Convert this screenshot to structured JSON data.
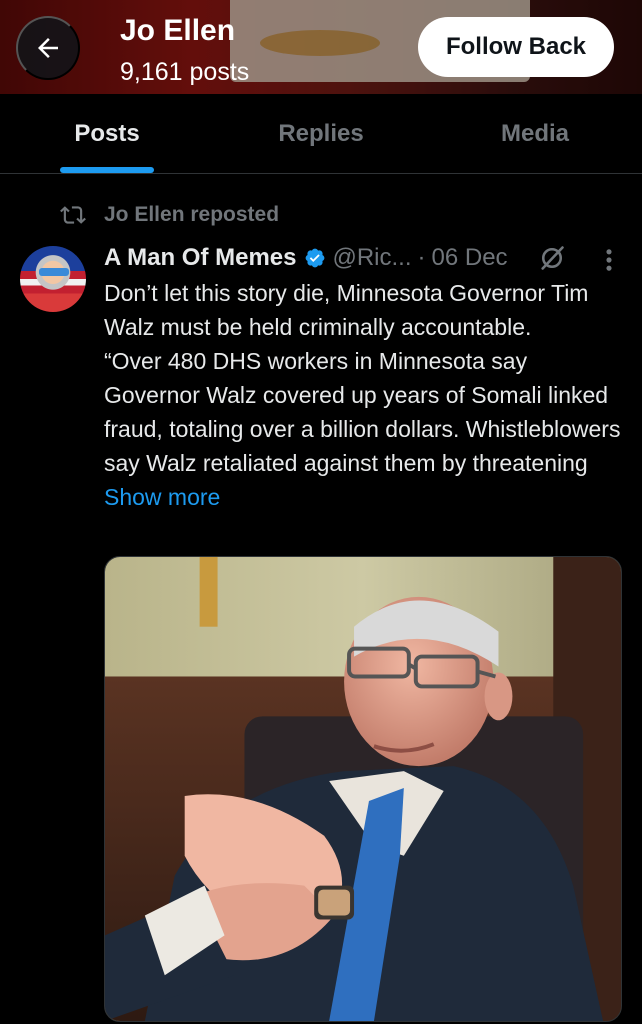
{
  "header": {
    "back_icon": "arrow-left-icon",
    "profile_name": "Jo Ellen",
    "post_count": "9,161 posts",
    "follow_button": "Follow Back",
    "banner_colors": {
      "primary": "#8a1410",
      "secondary": "#d8c9b8"
    }
  },
  "tabs": [
    {
      "label": "Posts",
      "active": true
    },
    {
      "label": "Replies",
      "active": false
    },
    {
      "label": "Media",
      "active": false
    }
  ],
  "feed": {
    "repost_label": "Jo Ellen reposted",
    "post": {
      "author_name": "A Man Of Memes",
      "verified": true,
      "handle": "@Ric...",
      "separator": "·",
      "date": "06 Dec",
      "text_lines": [
        "Don’t let this story die, Minnesota Governor Tim Walz must be held criminally accountable.",
        "“Over 480 DHS workers in Minnesota say Governor Walz covered up years of Somali linked fraud, totaling over a billion dollars. Whistleblowers say Walz retaliated against them by threatening"
      ],
      "show_more": "Show more"
    }
  },
  "colors": {
    "background": "#000000",
    "text": "#e7e9ea",
    "muted": "#71767b",
    "accent": "#1d9bf0",
    "divider": "#2f3336"
  }
}
